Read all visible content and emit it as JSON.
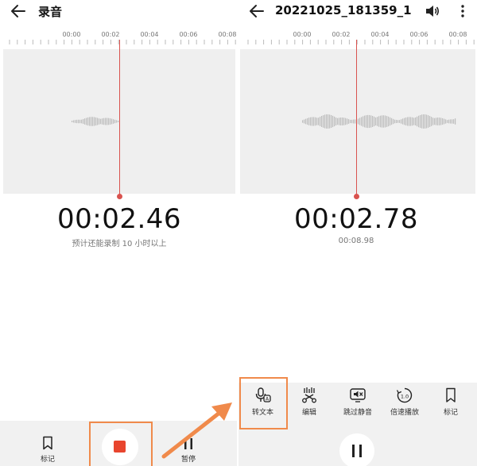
{
  "left": {
    "title": "录音",
    "ruler_labels": [
      "00:00",
      "00:02",
      "00:04",
      "00:06",
      "00:08"
    ],
    "timer": "00:02.46",
    "subtext": "预计还能录制 10 小时以上",
    "bottom": {
      "mark_label": "标记",
      "pause_label": "暂停"
    }
  },
  "right": {
    "title": "20221025_181359_1",
    "ruler_labels": [
      "00:00",
      "00:02",
      "00:04",
      "00:06",
      "00:08"
    ],
    "timer": "00:02.78",
    "duration": "00:08.98",
    "actions": [
      {
        "label": "转文本",
        "icon": "speech-to-text-icon"
      },
      {
        "label": "编辑",
        "icon": "scissors-icon"
      },
      {
        "label": "跳过静音",
        "icon": "skip-silence-icon"
      },
      {
        "label": "倍速播放",
        "icon": "speed-icon"
      },
      {
        "label": "标记",
        "icon": "bookmark-icon"
      }
    ],
    "speed_icon_text": "1.0"
  },
  "colors": {
    "playhead": "#d9534f",
    "stop": "#e8452e",
    "highlight": "#f08a4b",
    "waveform": "#bdbdbd"
  }
}
